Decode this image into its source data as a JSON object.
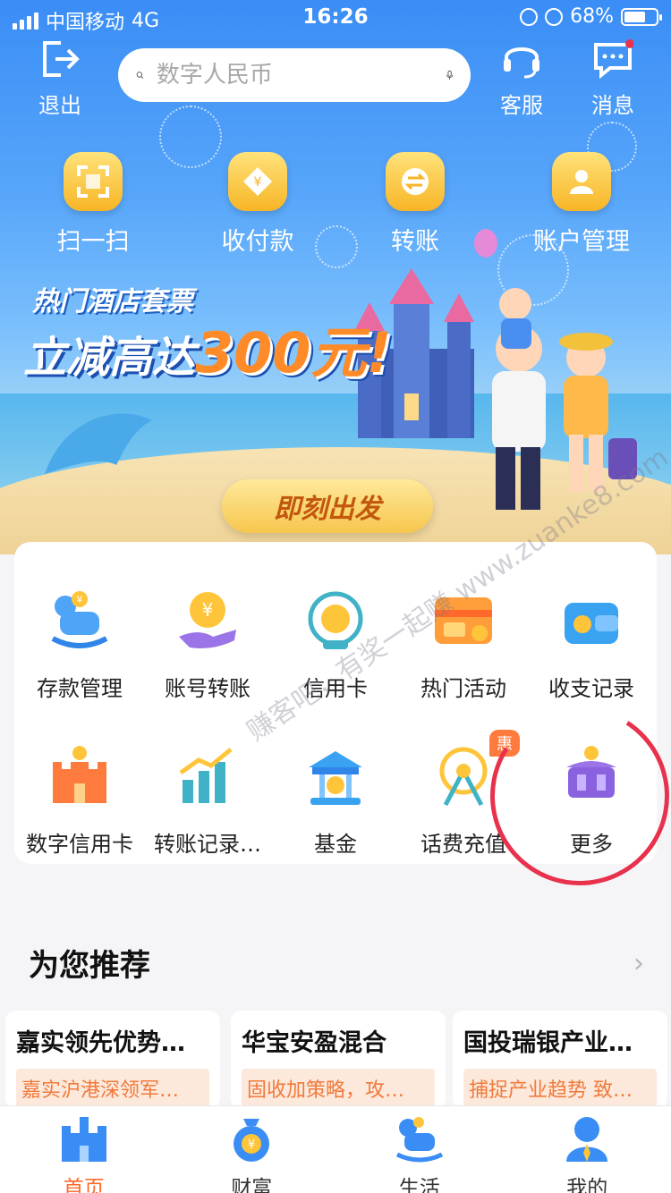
{
  "status_bar": {
    "carrier": "中国移动",
    "network": "4G",
    "time": "16:26",
    "battery": "68%",
    "battery_level": 0.68
  },
  "header": {
    "logout_label": "退出",
    "search_placeholder": "数字人民币",
    "service_label": "客服",
    "message_label": "消息"
  },
  "quick_actions": [
    {
      "label": "扫一扫",
      "icon": "scan-icon"
    },
    {
      "label": "收付款",
      "icon": "payment-icon"
    },
    {
      "label": "转账",
      "icon": "transfer-icon"
    },
    {
      "label": "账户管理",
      "icon": "account-icon"
    }
  ],
  "banner": {
    "subtitle": "热门酒店套票",
    "title_prefix": "立减高达",
    "title_highlight": "300元!",
    "cta": "即刻出发"
  },
  "services": [
    {
      "label": "存款管理",
      "icon": "rocking-horse-icon"
    },
    {
      "label": "账号转账",
      "icon": "coin-hand-icon"
    },
    {
      "label": "信用卡",
      "icon": "credit-card-icon"
    },
    {
      "label": "热门活动",
      "icon": "gift-card-icon"
    },
    {
      "label": "收支记录",
      "icon": "wallet-icon"
    },
    {
      "label": "数字信用卡",
      "icon": "castle-icon"
    },
    {
      "label": "转账记录…",
      "icon": "bar-chart-icon"
    },
    {
      "label": "基金",
      "icon": "carousel-icon"
    },
    {
      "label": "话费充值",
      "icon": "ferris-wheel-icon",
      "tag": "惠"
    },
    {
      "label": "更多",
      "icon": "more-carousel-icon"
    }
  ],
  "watermark": "赚客吧，有奖一起赚 www.zuanke8.com",
  "recommend": {
    "title": "为您推荐",
    "items": [
      {
        "title": "嘉实领先优势…",
        "desc": "嘉实沪港深领军…"
      },
      {
        "title": "华宝安盈混合",
        "desc": "固收加策略，攻…"
      },
      {
        "title": "国投瑞银产业…",
        "desc": "捕捉产业趋势 致…"
      }
    ]
  },
  "tabs": [
    {
      "label": "首页",
      "active": true,
      "icon": "home-castle-icon"
    },
    {
      "label": "财富",
      "active": false,
      "icon": "money-bag-icon"
    },
    {
      "label": "生活",
      "active": false,
      "icon": "rocking-horse-icon"
    },
    {
      "label": "我的",
      "active": false,
      "icon": "profile-icon"
    }
  ],
  "colors": {
    "accent": "#ff6a2a",
    "primary_blue": "#3a8df5",
    "mark_red": "#e8324d"
  }
}
